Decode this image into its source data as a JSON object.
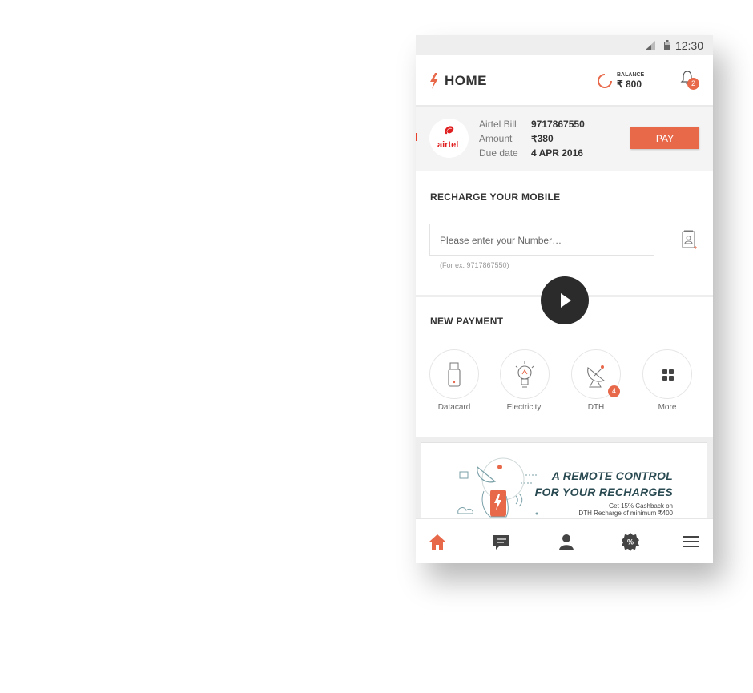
{
  "status_bar": {
    "time": "12:30"
  },
  "app_bar": {
    "title": "HOME",
    "balance_label": "BALANCE",
    "balance_value": "₹ 800",
    "notification_count": "2"
  },
  "bill_card": {
    "operator": "airtel",
    "rows": [
      {
        "label": "Airtel Bill",
        "value": "9717867550"
      },
      {
        "label": "Amount",
        "value": "₹380"
      },
      {
        "label": "Due date",
        "value": "4 APR 2016"
      }
    ],
    "pay_label": "PAY"
  },
  "recharge": {
    "title": "RECHARGE YOUR MOBILE",
    "input_placeholder": "Please enter your Number…",
    "hint": "(For ex. 9717867550)"
  },
  "new_payment": {
    "title": "NEW PAYMENT",
    "items": [
      {
        "label": "Datacard",
        "icon": "datacard-icon"
      },
      {
        "label": "Electricity",
        "icon": "bulb-icon"
      },
      {
        "label": "DTH",
        "icon": "satellite-dish-icon",
        "badge": "4"
      },
      {
        "label": "More",
        "icon": "grid-icon"
      }
    ]
  },
  "banner": {
    "headline_1": "A REMOTE CONTROL",
    "headline_2": "FOR YOUR RECHARGES",
    "sub_1": "Get 15% Cashback on",
    "sub_2": "DTH Recharge of minimum ₹400"
  },
  "bottom_nav": [
    {
      "name": "home",
      "icon": "home-icon",
      "active": true
    },
    {
      "name": "messages",
      "icon": "chat-icon"
    },
    {
      "name": "profile",
      "icon": "user-icon"
    },
    {
      "name": "offers",
      "icon": "offer-percent-icon"
    },
    {
      "name": "menu",
      "icon": "hamburger-icon"
    }
  ],
  "colors": {
    "accent": "#e8684a",
    "text": "#333333",
    "background_panel": "#f4f4f4"
  },
  "overlay": {
    "icon": "play-icon"
  }
}
